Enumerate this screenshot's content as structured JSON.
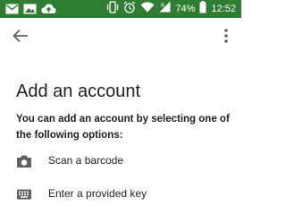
{
  "status_bar": {
    "battery_percent": "74%",
    "time": "12:52",
    "background_color": "#2e7d32",
    "icons_left": [
      "mail-icon",
      "image-icon",
      "cloud-upload-icon"
    ],
    "icons_right": [
      "vibrate-icon",
      "alarm-icon",
      "wifi-icon",
      "signal-icon",
      "battery-icon"
    ]
  },
  "app_bar": {
    "back_icon": "arrow-left-icon",
    "menu_icon": "more-vert-icon"
  },
  "page": {
    "title": "Add an account",
    "description": "You can add an account by selecting one of the following options:"
  },
  "options": [
    {
      "icon": "camera-icon",
      "label": "Scan a barcode"
    },
    {
      "icon": "keyboard-icon",
      "label": "Enter a provided key"
    }
  ]
}
